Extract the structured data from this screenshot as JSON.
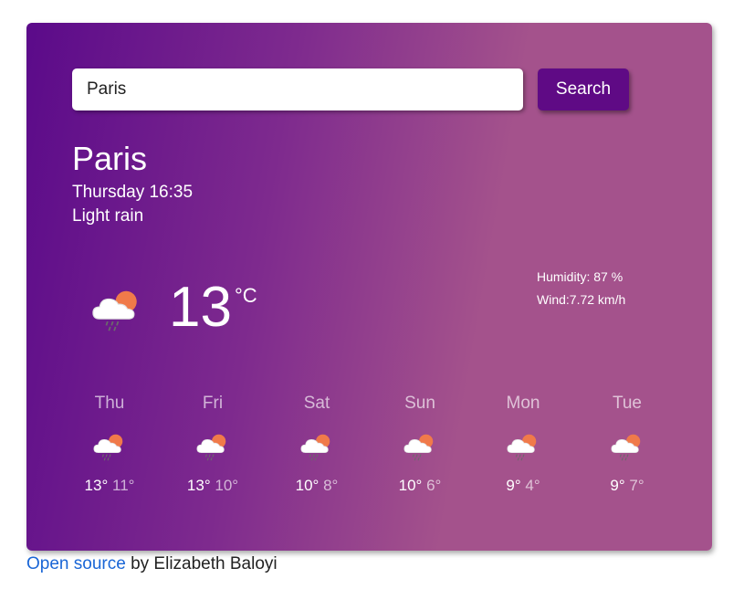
{
  "search": {
    "value": "Paris",
    "button_label": "Search"
  },
  "current": {
    "city": "Paris",
    "datetime": "Thursday 16:35",
    "description": "Light rain",
    "temperature": "13",
    "unit": "°C",
    "icon": "cloud-sun-rain-icon",
    "humidity_text": "Humidity: 87 %",
    "wind_text": "Wind:7.72 km/h"
  },
  "forecast": [
    {
      "day": "Thu",
      "max": "13°",
      "min": "11°",
      "icon": "cloud-sun-rain-icon"
    },
    {
      "day": "Fri",
      "max": "13°",
      "min": "10°",
      "icon": "cloud-sun-rain-icon"
    },
    {
      "day": "Sat",
      "max": "10°",
      "min": "8°",
      "icon": "cloud-sun-rain-icon"
    },
    {
      "day": "Sun",
      "max": "10°",
      "min": "6°",
      "icon": "cloud-sun-rain-icon"
    },
    {
      "day": "Mon",
      "max": "9°",
      "min": "4°",
      "icon": "cloud-sun-rain-icon"
    },
    {
      "day": "Tue",
      "max": "9°",
      "min": "7°",
      "icon": "cloud-sun-rain-icon"
    }
  ],
  "footer": {
    "link_text": "Open source",
    "suffix": " by Elizabeth Baloyi"
  },
  "colors": {
    "card_gradient_start": "#5b0a8a",
    "card_gradient_end": "#a4528c",
    "button_bg": "#5f0a85",
    "sun": "#f07a4a",
    "link": "#1a66d6"
  }
}
